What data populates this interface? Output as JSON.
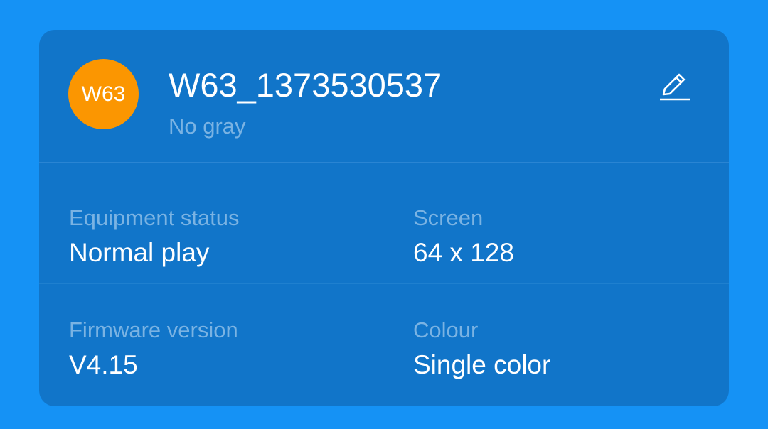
{
  "device": {
    "avatar_text": "W63",
    "name": "W63_1373530537",
    "subtitle": "No gray",
    "edit_icon": "pencil-icon"
  },
  "info": [
    {
      "label": "Equipment status",
      "value": "Normal play"
    },
    {
      "label": "Screen",
      "value": "64 x 128"
    },
    {
      "label": "Firmware version",
      "value": "V4.15"
    },
    {
      "label": "Colour",
      "value": "Single color"
    }
  ],
  "colors": {
    "background": "#1592f5",
    "card": "#1175c9",
    "avatar": "#fb9601",
    "label": "#7ab3e3",
    "value": "#ffffff"
  }
}
